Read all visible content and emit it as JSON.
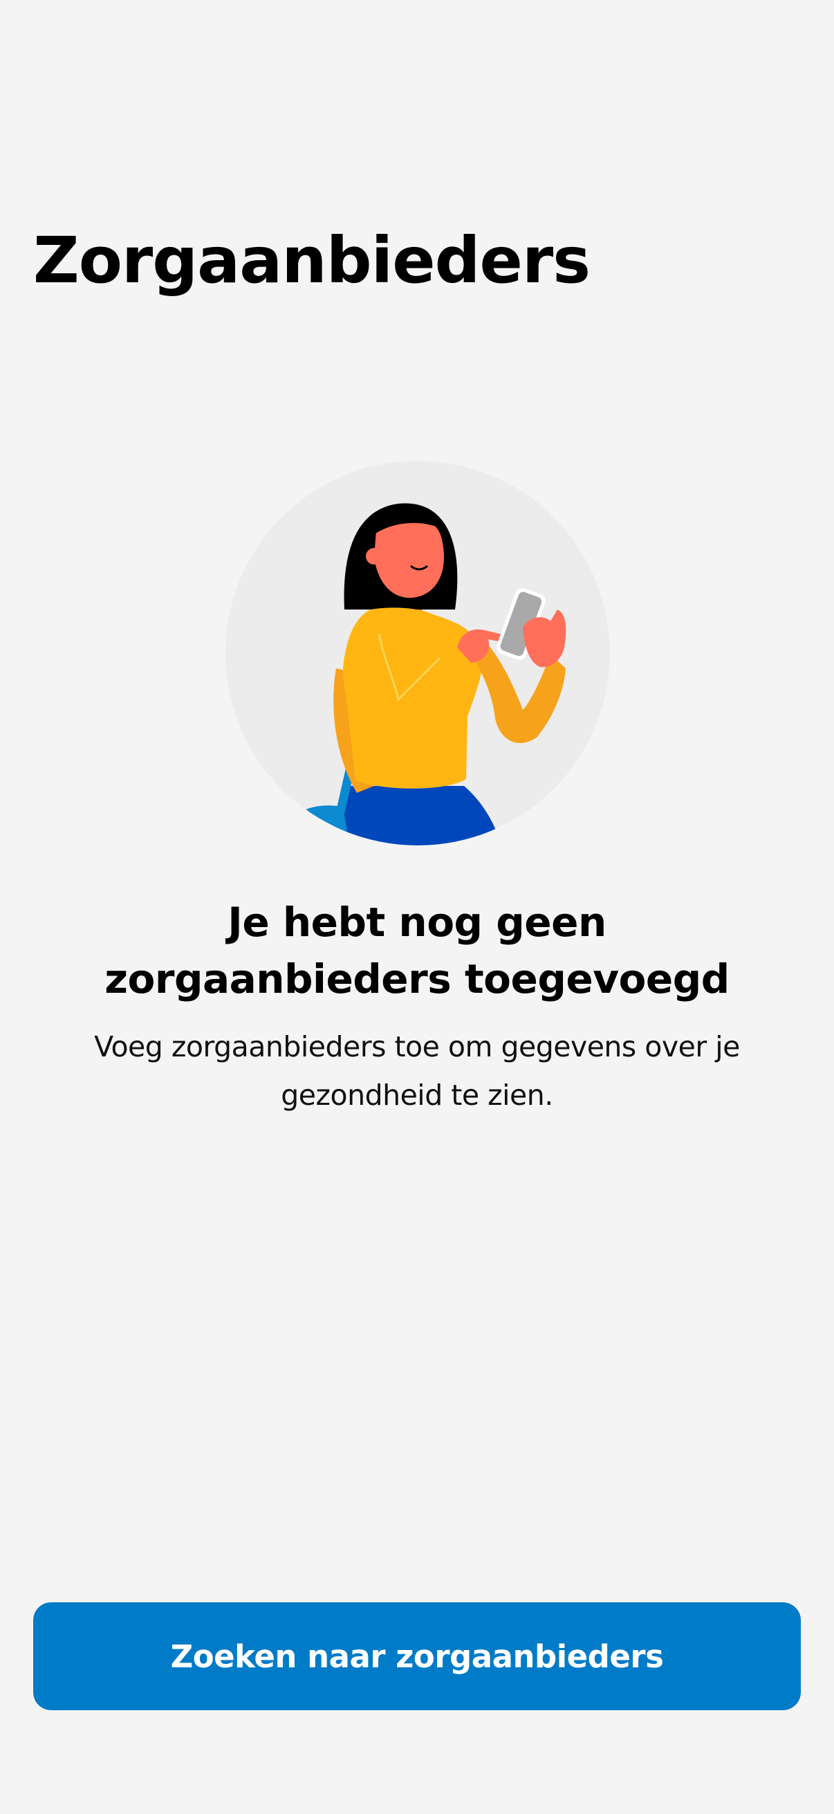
{
  "header": {
    "title": "Zorgaanbieders"
  },
  "illustration": {
    "icon": "woman-with-phone-illustration",
    "colors": {
      "circle": "#ececec",
      "skin": "#ff6f59",
      "hair": "#000000",
      "sweater": "#ffb612",
      "sweater_shadow": "#f7a21b",
      "skirt": "#0047bb",
      "bag": "#0b8ad0",
      "phone": "#a9a9a9"
    }
  },
  "empty_state": {
    "heading_line1": "Je hebt nog geen",
    "heading_line2": "zorgaanbieders toegevoegd",
    "body": "Voeg zorgaanbieders toe om gegevens over je gezondheid te zien."
  },
  "actions": {
    "search_label": "Zoeken naar zorgaanbieders",
    "button_color": "#007bc7"
  }
}
